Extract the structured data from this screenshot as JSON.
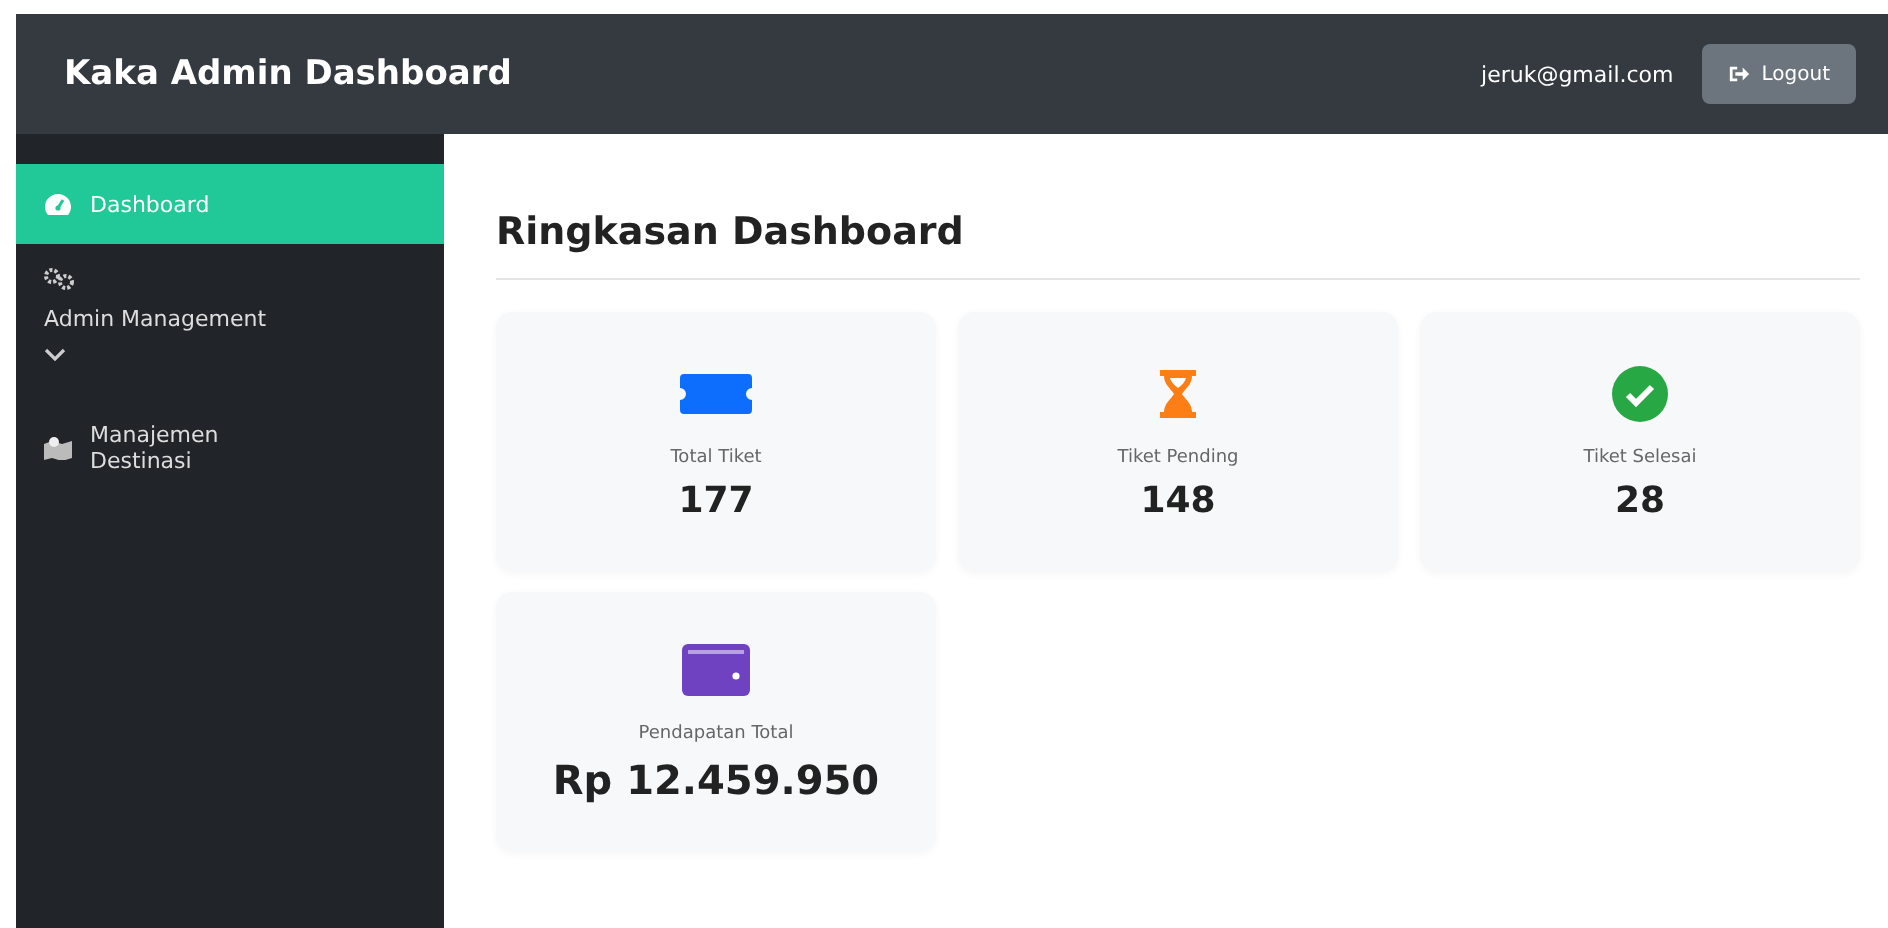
{
  "header": {
    "title": "Kaka Admin Dashboard",
    "user_email": "jeruk@gmail.com",
    "logout_button": "Logout"
  },
  "sidebar": {
    "items": [
      {
        "label": "Dashboard",
        "kind": "link",
        "selected": true
      },
      {
        "label": "Admin Management",
        "kind": "dropdown",
        "selected": false
      },
      {
        "label": "Manajemen Destinasi",
        "kind": "link",
        "selected": false
      }
    ]
  },
  "main": {
    "heading": "Ringkasan Dashboard",
    "cards": [
      {
        "color": "#0d6efd",
        "label": "Total Tiket",
        "value": "177"
      },
      {
        "color": "#fd7e14",
        "label": "Tiket Pending",
        "value": "148"
      },
      {
        "color": "#28a745",
        "label": "Tiket Selesai",
        "value": "28"
      },
      {
        "color": "#6f42c1",
        "label": "Pendapatan Total",
        "value": "Rp 12.459.950"
      }
    ]
  }
}
